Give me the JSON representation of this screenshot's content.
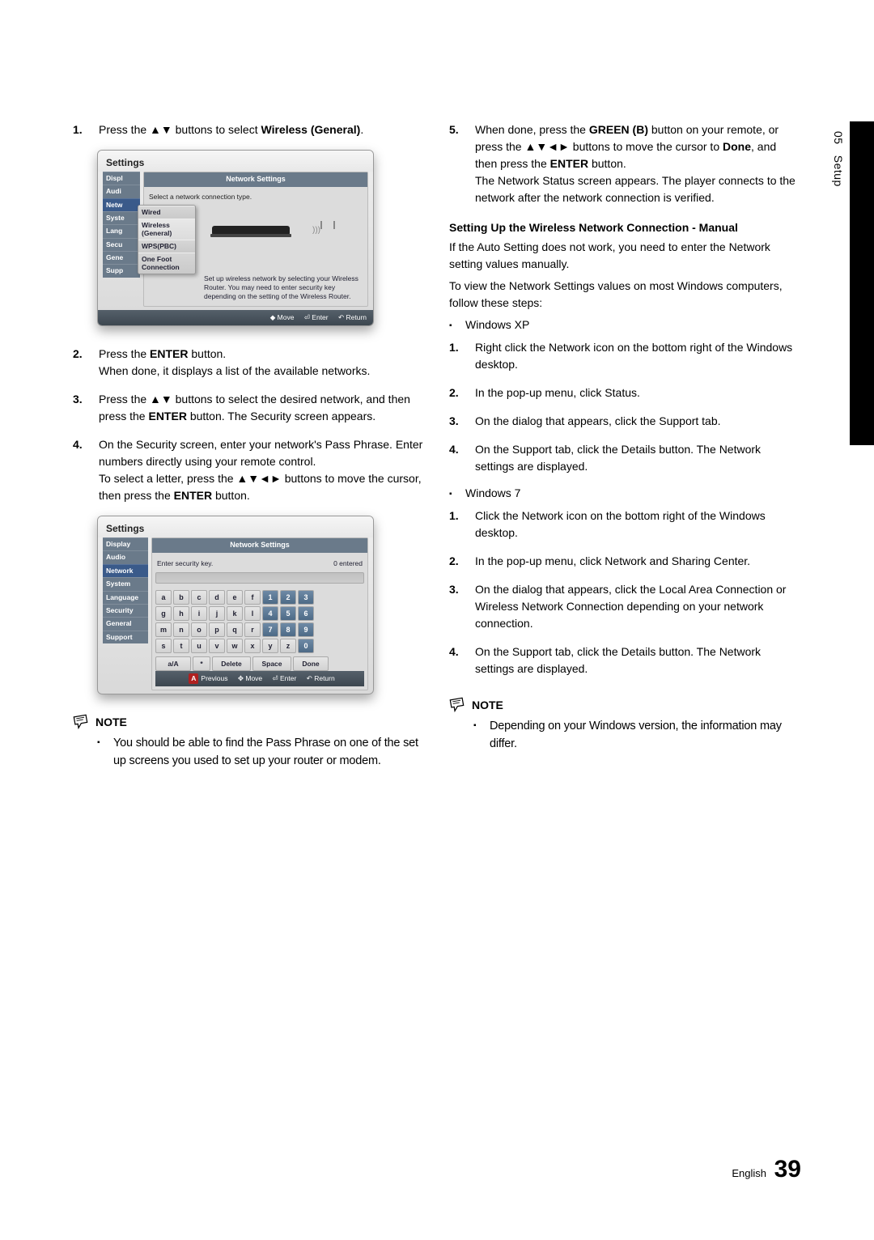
{
  "sideTab": {
    "chapter": "05",
    "title": "Setup"
  },
  "footer": {
    "lang": "English",
    "page": "39"
  },
  "left": {
    "items": [
      {
        "n": "1.",
        "html": "Press the ▲▼ buttons to select <b>Wireless (General)</b>."
      },
      {
        "n": "2.",
        "html": "Press the <b>ENTER</b> button.<br>When done, it displays a list of the available networks."
      },
      {
        "n": "3.",
        "html": "Press the ▲▼ buttons to select the desired network, and then press the <b>ENTER</b> button. The Security screen appears."
      },
      {
        "n": "4.",
        "html": "On the Security screen, enter your network's Pass Phrase. Enter numbers directly using your remote control.<br>To select a letter, press the ▲▼◄► buttons to move the cursor, then press the <b>ENTER</b> button."
      }
    ],
    "noteLabel": "NOTE",
    "noteText": "You should be able to find the Pass Phrase on one of the set up screens you used to set up your router or modem."
  },
  "right": {
    "items": [
      {
        "n": "5.",
        "html": "When done, press the <b>GREEN (B)</b> button on your remote, or press the ▲▼◄► buttons to move the cursor to <b>Done</b>, and then press the <b>ENTER</b> button.<br>The Network Status screen appears. The player connects to the network after the network connection is verified."
      }
    ],
    "heading2": "Setting Up the Wireless Network Connection - Manual",
    "para1": "If the Auto Setting does not work, you need to enter the Network setting values manually.",
    "para2": "To view the Network Settings values on most Windows computers, follow these steps:",
    "xpLabel": "Windows XP",
    "xpList": [
      {
        "n": "1.",
        "t": "Right click the Network icon on the bottom right of the Windows desktop."
      },
      {
        "n": "2.",
        "t": "In the pop-up menu, click Status."
      },
      {
        "n": "3.",
        "t": "On the dialog that appears, click the Support tab."
      },
      {
        "n": "4.",
        "t": "On the Support tab, click the Details button. The Network settings are displayed."
      }
    ],
    "w7Label": "Windows 7",
    "w7List": [
      {
        "n": "1.",
        "t": "Click the Network icon on the bottom right of the Windows desktop."
      },
      {
        "n": "2.",
        "t": "In the pop-up menu, click Network and Sharing Center."
      },
      {
        "n": "3.",
        "t": "On the dialog that appears, click the Local Area Connection or Wireless Network Connection depending on your network connection."
      },
      {
        "n": "4.",
        "t": "On the Support tab, click the Details button. The Network settings are displayed."
      }
    ],
    "noteLabel": "NOTE",
    "noteText": "Depending on your Windows version, the information may differ."
  },
  "mock1": {
    "title": "Settings",
    "paneHeader": "Network Settings",
    "desc": "Select a network connection type.",
    "sideItems": [
      "Displ",
      "Audi",
      "Netw",
      "Syste",
      "Lang",
      "Secu",
      "Gene",
      "Supp"
    ],
    "sideSelectedIndex": 2,
    "options": [
      "Wired",
      "Wireless (General)",
      "WPS(PBC)",
      "One Foot Connection"
    ],
    "optionSelectedIndex": 1,
    "help": "Set up wireless network by selecting your Wireless Router. You may need to enter security key depending on the setting of the Wireless Router.",
    "foot": {
      "move": "Move",
      "enter": "Enter",
      "return": "Return"
    }
  },
  "mock2": {
    "title": "Settings",
    "paneHeader": "Network Settings",
    "enterLabel": "Enter security key.",
    "enteredLabel": "0 entered",
    "sideItems": [
      "Display",
      "Audio",
      "Network",
      "System",
      "Language",
      "Security",
      "General",
      "Support"
    ],
    "sideSelectedIndex": 2,
    "keysRow1": [
      "a",
      "b",
      "c",
      "d",
      "e",
      "f",
      "1",
      "2",
      "3"
    ],
    "keysRow2": [
      "g",
      "h",
      "i",
      "j",
      "k",
      "l",
      "4",
      "5",
      "6"
    ],
    "keysRow3": [
      "m",
      "n",
      "o",
      "p",
      "q",
      "r",
      "7",
      "8",
      "9"
    ],
    "keysRow4": [
      "s",
      "t",
      "u",
      "v",
      "w",
      "x",
      "y",
      "z",
      "0"
    ],
    "bottomKeys": {
      "aA": "a/A",
      "star": "*",
      "delete": "Delete",
      "space": "Space",
      "done": "Done"
    },
    "foot": {
      "prev": "Previous",
      "move": "Move",
      "enter": "Enter",
      "return": "Return"
    }
  }
}
